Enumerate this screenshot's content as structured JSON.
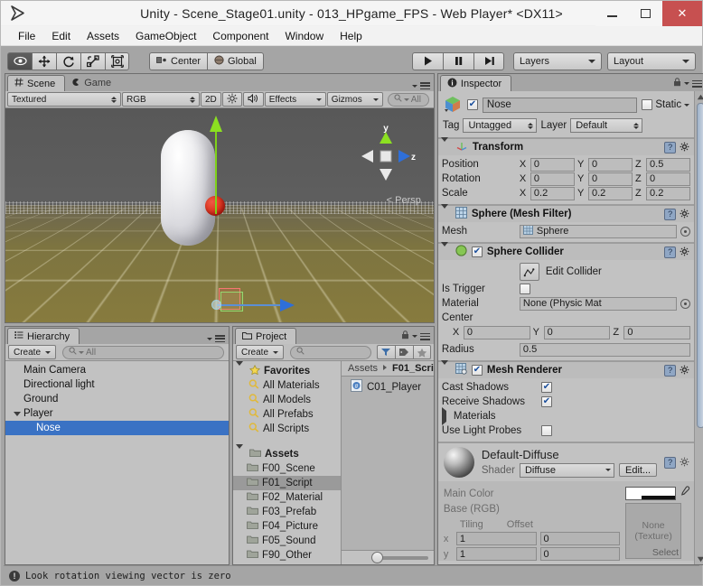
{
  "window": {
    "title": "Unity - Scene_Stage01.unity - 013_HPgame_FPS - Web Player* <DX11>",
    "logo_icon": "unity-logo-icon",
    "minimize_label": "",
    "maximize_label": "",
    "close_label": "✕"
  },
  "menubar": {
    "items": [
      "File",
      "Edit",
      "Assets",
      "GameObject",
      "Component",
      "Window",
      "Help"
    ]
  },
  "toolbar": {
    "tools": [
      {
        "name": "hand-tool",
        "icon": "eye-icon",
        "active": true
      },
      {
        "name": "move-tool",
        "icon": "move-arrows-icon",
        "active": false
      },
      {
        "name": "rotate-tool",
        "icon": "rotate-icon",
        "active": false
      },
      {
        "name": "scale-tool",
        "icon": "scale-icon",
        "active": false
      },
      {
        "name": "rect-tool",
        "icon": "rect-transform-icon",
        "active": false
      }
    ],
    "pivot_label": "Center",
    "pivot_icon": "pivot-center-icon",
    "space_label": "Global",
    "space_icon": "globe-icon",
    "play_label": "▶",
    "pause_label": "❚❚",
    "step_label": "▶❘",
    "layers_label": "Layers",
    "layout_label": "Layout"
  },
  "scene_panel": {
    "tabs": [
      {
        "label": "Scene",
        "icon": "scene-grid-icon",
        "active": true
      },
      {
        "label": "Game",
        "icon": "game-pacman-icon",
        "active": false
      }
    ],
    "draw_mode": "Textured",
    "render_mode": "RGB",
    "two_d_label": "2D",
    "lighting_icon": "sun-icon",
    "audio_icon": "speaker-icon",
    "effects_label": "Effects",
    "gizmos_label": "Gizmos",
    "search_placeholder": "All",
    "search_icon": "search-icon",
    "view_axis_x": "",
    "view_axis_y": "y",
    "view_axis_z": "z",
    "perspective_label": "Persp"
  },
  "hierarchy_panel": {
    "tab_label": "Hierarchy",
    "tab_icon": "hierarchy-icon",
    "create_label": "Create",
    "search_placeholder": "All",
    "items": [
      {
        "label": "Main Camera",
        "depth": 0,
        "expandable": false,
        "selected": false
      },
      {
        "label": "Directional light",
        "depth": 0,
        "expandable": false,
        "selected": false
      },
      {
        "label": "Ground",
        "depth": 0,
        "expandable": false,
        "selected": false
      },
      {
        "label": "Player",
        "depth": 0,
        "expandable": true,
        "selected": false
      },
      {
        "label": "Nose",
        "depth": 1,
        "expandable": false,
        "selected": true
      }
    ],
    "selection_color": "#3a72c4"
  },
  "project_panel": {
    "tab_label": "Project",
    "tab_icon": "folder-icon",
    "create_label": "Create",
    "search_placeholder": "",
    "lock_icon": "lock-icon",
    "tool_icons": [
      "filter-by-type-icon",
      "filter-by-label-icon",
      "favorites-star-icon"
    ],
    "favorites_label": "Favorites",
    "favorites": [
      {
        "label": "All Materials",
        "icon": "search-icon"
      },
      {
        "label": "All Models",
        "icon": "search-icon"
      },
      {
        "label": "All Prefabs",
        "icon": "search-icon"
      },
      {
        "label": "All Scripts",
        "icon": "search-icon"
      }
    ],
    "assets_label": "Assets",
    "folders": [
      {
        "label": "F00_Scene",
        "selected": false
      },
      {
        "label": "F01_Script",
        "selected": true
      },
      {
        "label": "F02_Material",
        "selected": false
      },
      {
        "label": "F03_Prefab",
        "selected": false
      },
      {
        "label": "F04_Picture",
        "selected": false
      },
      {
        "label": "F05_Sound",
        "selected": false
      },
      {
        "label": "F90_Other",
        "selected": false
      }
    ],
    "breadcrumb_root": "Assets",
    "breadcrumb_current": "F01_Scri",
    "items": [
      {
        "label": "C01_Player",
        "icon": "csharp-script-icon"
      }
    ],
    "zoom_slider_value": 18
  },
  "inspector": {
    "tab_label": "Inspector",
    "tab_icon": "info-icon",
    "lock_icon": "lock-icon",
    "object_icon": "gameobject-cube-icon",
    "enabled": true,
    "object_name": "Nose",
    "static_label": "Static",
    "static_checked": false,
    "tag_label": "Tag",
    "tag_value": "Untagged",
    "layer_label": "Layer",
    "layer_value": "Default",
    "components": [
      {
        "name": "Transform",
        "icon": "transform-axis-icon",
        "expanded": true,
        "has_checkbox": false,
        "rows": [
          {
            "label": "Position",
            "fields": [
              {
                "axis": "X",
                "value": "0"
              },
              {
                "axis": "Y",
                "value": "0"
              },
              {
                "axis": "Z",
                "value": "0.5"
              }
            ]
          },
          {
            "label": "Rotation",
            "fields": [
              {
                "axis": "X",
                "value": "0"
              },
              {
                "axis": "Y",
                "value": "0"
              },
              {
                "axis": "Z",
                "value": "0"
              }
            ]
          },
          {
            "label": "Scale",
            "fields": [
              {
                "axis": "X",
                "value": "0.2"
              },
              {
                "axis": "Y",
                "value": "0.2"
              },
              {
                "axis": "Z",
                "value": "0.2"
              }
            ]
          }
        ]
      },
      {
        "name": "Sphere (Mesh Filter)",
        "icon": "mesh-filter-icon",
        "expanded": true,
        "has_checkbox": false,
        "mesh_label": "Mesh",
        "mesh_value": "Sphere",
        "mesh_icon": "mesh-icon"
      },
      {
        "name": "Sphere Collider",
        "icon": "collider-green-icon",
        "expanded": true,
        "has_checkbox": true,
        "checked": true,
        "edit_collider_label": "Edit Collider",
        "edit_collider_icon": "edit-collider-icon",
        "is_trigger_label": "Is Trigger",
        "is_trigger_checked": false,
        "material_label": "Material",
        "material_value": "None (Physic Mat",
        "center_label": "Center",
        "center": [
          {
            "axis": "X",
            "value": "0"
          },
          {
            "axis": "Y",
            "value": "0"
          },
          {
            "axis": "Z",
            "value": "0"
          }
        ],
        "radius_label": "Radius",
        "radius_value": "0.5"
      },
      {
        "name": "Mesh Renderer",
        "icon": "mesh-renderer-icon",
        "expanded": true,
        "has_checkbox": true,
        "checked": true,
        "cast_shadows_label": "Cast Shadows",
        "cast_shadows_checked": true,
        "receive_shadows_label": "Receive Shadows",
        "receive_shadows_checked": true,
        "materials_label": "Materials",
        "use_light_probes_label": "Use Light Probes",
        "use_light_probes_checked": false
      }
    ],
    "material": {
      "name": "Default-Diffuse",
      "preview_icon": "material-sphere-preview",
      "shader_label": "Shader",
      "shader_value": "Diffuse",
      "edit_label": "Edit...",
      "main_color_label": "Main Color",
      "main_color_value": "#ffffff",
      "eyedropper_icon": "eyedropper-icon",
      "base_rgb_label": "Base (RGB)",
      "texture_none_line1": "None",
      "texture_none_line2": "(Texture)",
      "select_label": "Select",
      "tiling_label": "Tiling",
      "offset_label": "Offset",
      "rows": [
        {
          "axis": "x",
          "tiling": "1",
          "offset": "0"
        },
        {
          "axis": "y",
          "tiling": "1",
          "offset": "0"
        }
      ]
    }
  },
  "statusbar": {
    "icon": "warning-icon",
    "message": "Look rotation viewing vector is zero"
  }
}
